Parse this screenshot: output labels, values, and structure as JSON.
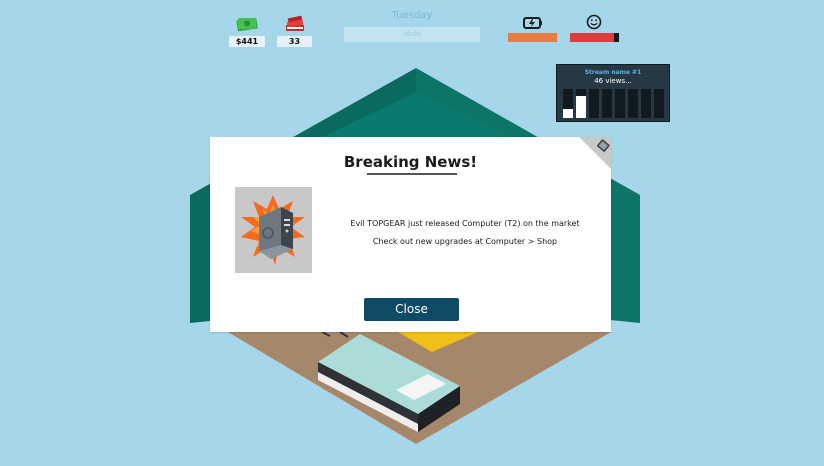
{
  "hud": {
    "money": "$441",
    "books": "33",
    "day": "Tuesday",
    "time_label": "00:00",
    "energy_level": 1.0,
    "happiness_level": 0.9,
    "energy_icon": "battery-icon",
    "happiness_icon": "smiley-icon",
    "money_icon": "cash-icon",
    "books_icon": "books-icon"
  },
  "stream": {
    "name": "Stream name #1",
    "views": "46 views...",
    "bar_levels": [
      0.3,
      0.75,
      0,
      0,
      0,
      0,
      0,
      0
    ]
  },
  "dialog": {
    "title": "Breaking News!",
    "line1": "Evil TOPGEAR just released Computer (T2) on the market",
    "line2": "Check out new upgrades at Computer > Shop",
    "close_label": "Close",
    "image_icon": "computer-tower-icon"
  },
  "colors": {
    "background": "#a6d6ea",
    "energy": "#e67c42",
    "happiness": "#e03c3c",
    "button": "#0f4a67",
    "wall": "#0b6a60",
    "floor": "#a7876a"
  }
}
